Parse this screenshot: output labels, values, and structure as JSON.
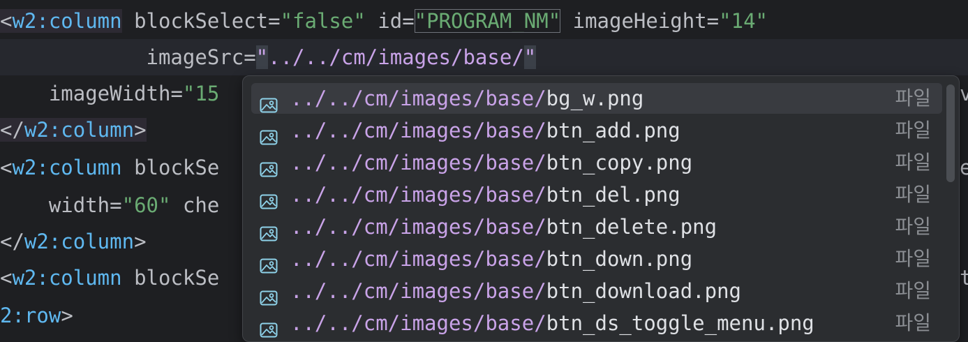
{
  "editor": {
    "line1": {
      "open": "<",
      "tag": "w2:column",
      "a1": " blockSelect=",
      "v1": "\"false\"",
      "a2": " id=",
      "v2": "\"PROGRAM_NM\"",
      "a3": " imageHeight=",
      "v3": "\"14\""
    },
    "line2": {
      "indent": "            ",
      "a1": "imageSrc=",
      "q1": "\"",
      "v1": "../../cm/images/base/",
      "q2": "\""
    },
    "line3": {
      "indent": "    ",
      "a1": "imageWidth=",
      "v1": "\"15",
      "tail": "v"
    },
    "line4": {
      "close": "</",
      "tag": "w2:column",
      "end": ">"
    },
    "line5": {
      "open": "<",
      "tag": "w2:column",
      "a1": " blockSe",
      "tail": "e"
    },
    "line6": {
      "indent": "    ",
      "a1": "width=",
      "v1": "\"60\"",
      "a2": " che"
    },
    "line7": {
      "close": "</",
      "tag": "w2:column",
      "end": ">"
    },
    "line8": {
      "open": "<",
      "tag": "w2:column",
      "a1": " blockSe",
      "tail": "t"
    },
    "line9": {
      "tag": "2:row",
      "end": ">"
    }
  },
  "completion": {
    "prefix": "../../cm/images/base/",
    "kind_label": "파일",
    "icon": "image-file-icon",
    "items": [
      {
        "file": "bg_w.png"
      },
      {
        "file": "btn_add.png"
      },
      {
        "file": "btn_copy.png"
      },
      {
        "file": "btn_del.png"
      },
      {
        "file": "btn_delete.png"
      },
      {
        "file": "btn_down.png"
      },
      {
        "file": "btn_download.png"
      },
      {
        "file": "btn_ds_toggle_menu.png"
      }
    ]
  },
  "colors": {
    "background": "#1e1f22",
    "tag": "#5fb8f0",
    "string": "#6aab73",
    "path_string": "#c9a3e8",
    "popup": "#2b2d30",
    "selected_row": "#393b40"
  }
}
